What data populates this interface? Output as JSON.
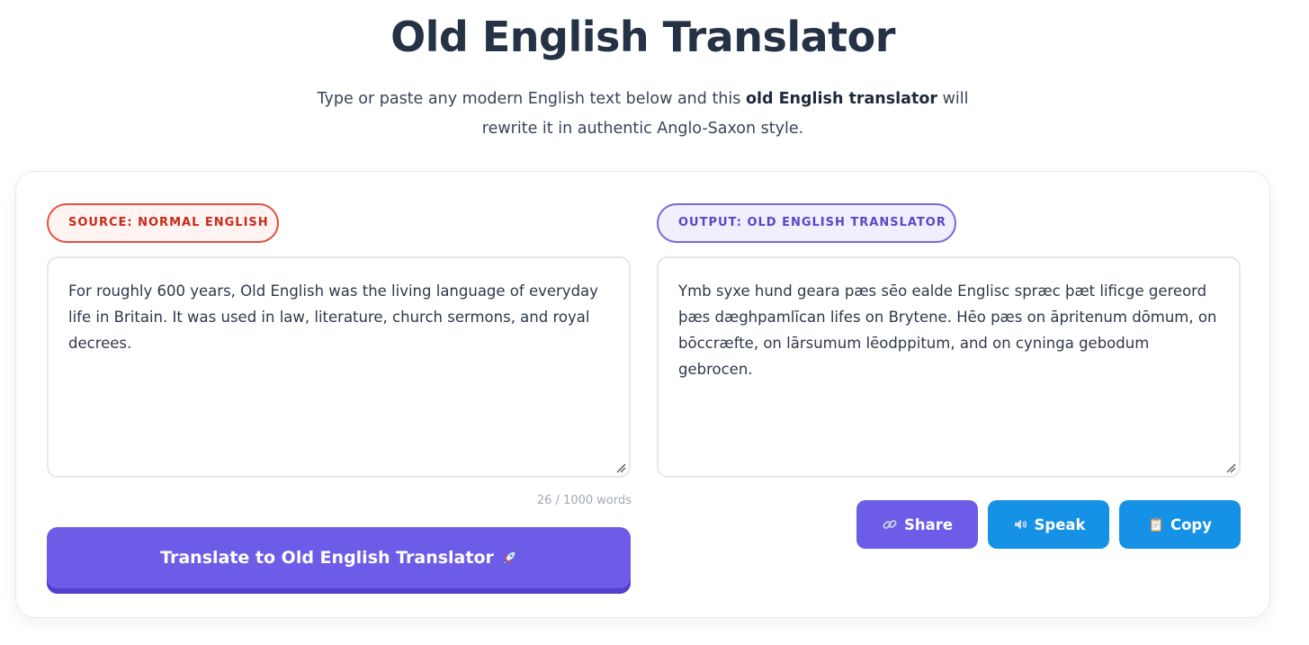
{
  "header": {
    "title": "Old English Translator",
    "subtitle_before": "Type or paste any modern English text below and this ",
    "subtitle_bold": "old English translator",
    "subtitle_after": " will rewrite it in authentic Anglo-Saxon style."
  },
  "source": {
    "badge": "SOURCE: NORMAL ENGLISH",
    "text": "For roughly 600 years, Old English was the living language of everyday life in Britain. It was used in law, literature, church sermons, and royal decrees.",
    "word_count": "26 / 1000 words"
  },
  "output": {
    "badge": "OUTPUT: OLD ENGLISH TRANSLATOR",
    "text": "Ymb syxe hund geara pæs sēo ealde Englisc spræc þæt lificge gereord þæs dæghpamlīcan lifes on Brytene. Hēo pæs on āpritenum dōmum, on bōccræfte, on lārsumum lēodppitum, and on cyninga gebodum gebrocen."
  },
  "actions": {
    "translate_label": "Translate to Old English Translator",
    "translate_icon": "rocket-icon",
    "share_label": "Share",
    "share_icon": "link-icon",
    "speak_label": "Speak",
    "speak_icon": "speaker-icon",
    "copy_label": "Copy",
    "copy_icon": "clipboard-icon"
  },
  "colors": {
    "title": "#253246",
    "primary": "#6c5ce7",
    "secondary": "#1591e6",
    "source_accent": "#e2503f",
    "output_accent": "#7b66dc"
  }
}
